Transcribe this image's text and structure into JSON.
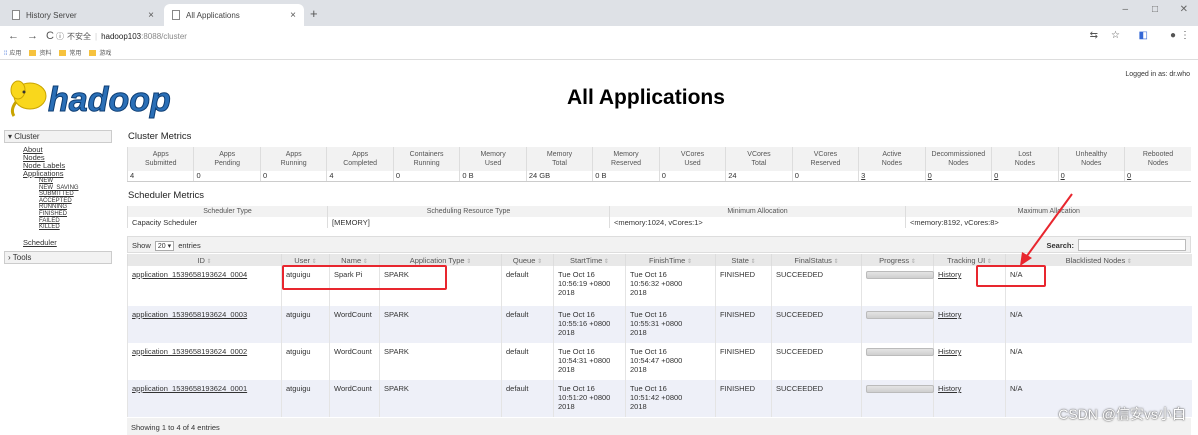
{
  "browser": {
    "tabs": [
      {
        "title": "History Server"
      },
      {
        "title": "All Applications"
      }
    ],
    "security_label": "不安全",
    "url_host": "hadoop103",
    "url_path": ":8088/cluster",
    "bookmarks": [
      "应用",
      "资料",
      "常用",
      "游戏"
    ],
    "new_tab": "+",
    "window_controls": [
      "–",
      "□",
      "✕"
    ]
  },
  "page": {
    "title": "All Applications",
    "logged_in": "Logged in as: dr.who",
    "logo_text": "hadoop"
  },
  "sidebar": {
    "cluster_label": "▾ Cluster",
    "links": [
      "About",
      "Nodes",
      "Node Labels",
      "Applications"
    ],
    "app_states": [
      "NEW",
      "NEW_SAVING",
      "SUBMITTED",
      "ACCEPTED",
      "RUNNING",
      "FINISHED",
      "FAILED",
      "KILLED"
    ],
    "scheduler": "Scheduler",
    "tools_label": "› Tools"
  },
  "cluster_metrics": {
    "title": "Cluster Metrics",
    "headers": [
      [
        "Apps",
        "Submitted"
      ],
      [
        "Apps",
        "Pending"
      ],
      [
        "Apps",
        "Running"
      ],
      [
        "Apps",
        "Completed"
      ],
      [
        "Containers",
        "Running"
      ],
      [
        "Memory",
        "Used"
      ],
      [
        "Memory",
        "Total"
      ],
      [
        "Memory",
        "Reserved"
      ],
      [
        "VCores",
        "Used"
      ],
      [
        "VCores",
        "Total"
      ],
      [
        "VCores",
        "Reserved"
      ],
      [
        "Active",
        "Nodes"
      ],
      [
        "Decommissioned",
        "Nodes"
      ],
      [
        "Lost",
        "Nodes"
      ],
      [
        "Unhealthy",
        "Nodes"
      ],
      [
        "Rebooted",
        "Nodes"
      ]
    ],
    "values": [
      "4",
      "0",
      "0",
      "4",
      "0",
      "0 B",
      "24 GB",
      "0 B",
      "0",
      "24",
      "0",
      "3",
      "0",
      "0",
      "0",
      "0"
    ]
  },
  "scheduler_metrics": {
    "title": "Scheduler Metrics",
    "headers": [
      "Scheduler Type",
      "Scheduling Resource Type",
      "Minimum Allocation",
      "Maximum Allocation"
    ],
    "values": [
      "Capacity Scheduler",
      "[MEMORY]",
      "<memory:1024, vCores:1>",
      "<memory:8192, vCores:8>"
    ]
  },
  "controls": {
    "show": "Show",
    "entries_value": "20",
    "entries": "entries",
    "search": "Search:"
  },
  "apps_table": {
    "headers": [
      "ID",
      "User",
      "Name",
      "Application Type",
      "Queue",
      "StartTime",
      "FinishTime",
      "State",
      "FinalStatus",
      "Progress",
      "Tracking UI",
      "Blacklisted Nodes"
    ],
    "rows": [
      {
        "id": "application_1539658193624_0004",
        "user": "atguigu",
        "name": "Spark Pi",
        "type": "SPARK",
        "queue": "default",
        "start": [
          "Tue Oct 16",
          "10:56:19 +0800",
          "2018"
        ],
        "finish": [
          "Tue Oct 16",
          "10:56:32 +0800",
          "2018"
        ],
        "state": "FINISHED",
        "final": "SUCCEEDED",
        "progress": 1.0,
        "tracking": "History",
        "blacklisted": "N/A"
      },
      {
        "id": "application_1539658193624_0003",
        "user": "atguigu",
        "name": "WordCount",
        "type": "SPARK",
        "queue": "default",
        "start": [
          "Tue Oct 16",
          "10:55:16 +0800",
          "2018"
        ],
        "finish": [
          "Tue Oct 16",
          "10:55:31 +0800",
          "2018"
        ],
        "state": "FINISHED",
        "final": "SUCCEEDED",
        "progress": 1.0,
        "tracking": "History",
        "blacklisted": "N/A"
      },
      {
        "id": "application_1539658193624_0002",
        "user": "atguigu",
        "name": "WordCount",
        "type": "SPARK",
        "queue": "default",
        "start": [
          "Tue Oct 16",
          "10:54:31 +0800",
          "2018"
        ],
        "finish": [
          "Tue Oct 16",
          "10:54:47 +0800",
          "2018"
        ],
        "state": "FINISHED",
        "final": "SUCCEEDED",
        "progress": 1.0,
        "tracking": "History",
        "blacklisted": "N/A"
      },
      {
        "id": "application_1539658193624_0001",
        "user": "atguigu",
        "name": "WordCount",
        "type": "SPARK",
        "queue": "default",
        "start": [
          "Tue Oct 16",
          "10:51:20 +0800",
          "2018"
        ],
        "finish": [
          "Tue Oct 16",
          "10:51:42 +0800",
          "2018"
        ],
        "state": "FINISHED",
        "final": "SUCCEEDED",
        "progress": 1.0,
        "tracking": "History",
        "blacklisted": "N/A"
      }
    ]
  },
  "footer": {
    "text": "Showing 1 to 4 of 4 entries"
  },
  "watermark": "CSDN @信安vs小白",
  "colors": {
    "annotation_red": "#e8262e",
    "logo_yellow": "#f9d71c",
    "logo_blue": "#2a6fb7"
  }
}
